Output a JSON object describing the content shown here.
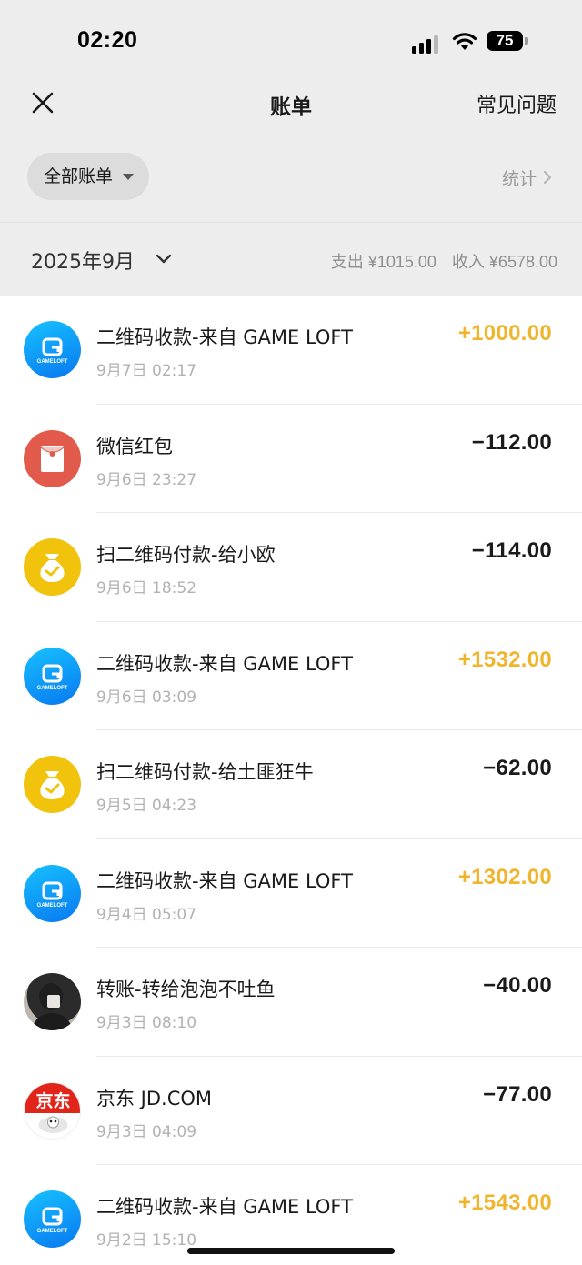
{
  "status": {
    "time": "02:20",
    "battery": "75"
  },
  "nav": {
    "title": "账单",
    "faq": "常见问题"
  },
  "filter": {
    "all_bills": "全部账单",
    "stats": "统计"
  },
  "month": {
    "label": "2025年9月",
    "expense": "支出 ¥1015.00",
    "income": "收入 ¥6578.00"
  },
  "colors": {
    "income_amount": "#f0b52d",
    "expense_amount": "#1a1a1a",
    "gameloft_blue": "#0e9af5",
    "redpacket": "#e15a4c",
    "moneybag": "#f2c30d",
    "jd_red": "#e1251b"
  },
  "transactions": [
    {
      "title": "二维码收款-来自 GAME LOFT",
      "time": "9月7日 02:17",
      "amount": "+1000.00",
      "kind": "income",
      "icon": "gameloft-logo-icon",
      "logo_text": "GAMELOFT"
    },
    {
      "title": "微信红包",
      "time": "9月6日 23:27",
      "amount": "−112.00",
      "kind": "expense",
      "icon": "red-packet-icon"
    },
    {
      "title": "扫二维码付款-给小欧",
      "time": "9月6日 18:52",
      "amount": "−114.00",
      "kind": "expense",
      "icon": "money-bag-icon"
    },
    {
      "title": "二维码收款-来自 GAME LOFT",
      "time": "9月6日 03:09",
      "amount": "+1532.00",
      "kind": "income",
      "icon": "gameloft-logo-icon",
      "logo_text": "GAMELOFT"
    },
    {
      "title": "扫二维码付款-给土匪狂牛",
      "time": "9月5日 04:23",
      "amount": "−62.00",
      "kind": "expense",
      "icon": "money-bag-icon"
    },
    {
      "title": "二维码收款-来自 GAME LOFT",
      "time": "9月4日 05:07",
      "amount": "+1302.00",
      "kind": "income",
      "icon": "gameloft-logo-icon",
      "logo_text": "GAMELOFT"
    },
    {
      "title": "转账-转给泡泡不吐鱼",
      "time": "9月3日 08:10",
      "amount": "−40.00",
      "kind": "expense",
      "icon": "user-avatar-photo"
    },
    {
      "title": "京东 JD.COM",
      "time": "9月3日 04:09",
      "amount": "−77.00",
      "kind": "expense",
      "icon": "jd-logo-icon",
      "logo_text": "京东"
    },
    {
      "title": "二维码收款-来自 GAME LOFT",
      "time": "9月2日 15:10",
      "amount": "+1543.00",
      "kind": "income",
      "icon": "gameloft-logo-icon",
      "logo_text": "GAMELOFT"
    }
  ]
}
